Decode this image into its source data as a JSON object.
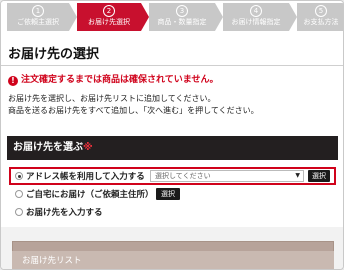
{
  "steps": [
    {
      "num": "1",
      "label": "ご依頼主選択",
      "active": false
    },
    {
      "num": "2",
      "label": "お届け先選択",
      "active": true
    },
    {
      "num": "3",
      "label": "商品・数量指定",
      "active": false
    },
    {
      "num": "4",
      "label": "お届け情報指定",
      "active": false
    },
    {
      "num": "5",
      "label": "お支払方法",
      "active": false
    }
  ],
  "page": {
    "title": "お届け先の選択",
    "warning": "注文確定するまでは商品は確保されていません。",
    "info_line1": "お届け先を選択し、お届け先リストに追加してください。",
    "info_line2": "商品を送るお届け先をすべて追加し、「次へ進む」を押してください。"
  },
  "section": {
    "title": "お届け先を選ぶ",
    "required_mark": "※"
  },
  "options": {
    "address_book": {
      "label": "アドレス帳を利用して入力する",
      "selected": true
    },
    "select_placeholder": "選択してください",
    "select_button": "選択",
    "home": {
      "label": "ご自宅にお届け（ご依頼主住所）",
      "selected": false
    },
    "home_button": "選択",
    "manual": {
      "label": "お届け先を入力する",
      "selected": false
    }
  },
  "list": {
    "header": "お届け先リスト"
  },
  "colors": {
    "accent": "#c8102e",
    "header_bg": "#231f20",
    "step_inactive": "#c8c8c8",
    "list_header": "#c9b9b1"
  }
}
